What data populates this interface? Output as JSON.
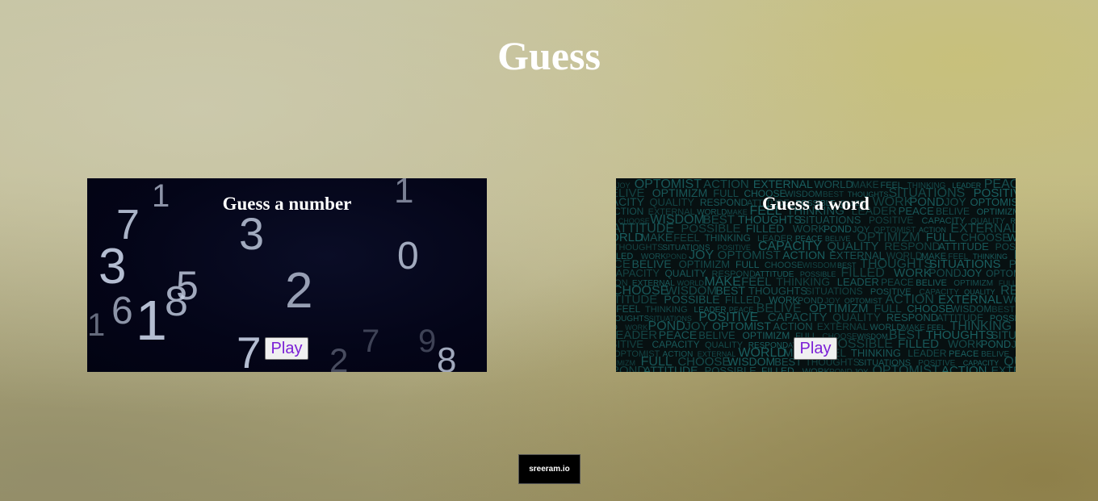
{
  "page": {
    "title": "Guess"
  },
  "cards": [
    {
      "title": "Guess a number",
      "play_label": "Play",
      "background_digits": [
        "7",
        "3",
        "1",
        "3",
        "5",
        "8",
        "6",
        "1",
        "2",
        "0",
        "1",
        "7",
        "2",
        "8",
        "9",
        "7",
        "1"
      ]
    },
    {
      "title": "Guess a word",
      "play_label": "Play",
      "background_words": [
        "JOY",
        "OPTOMIST",
        "ACTION",
        "EXTERNAL",
        "WORLD",
        "MAKE",
        "FEEL",
        "THINKING",
        "LEADER",
        "PEACE",
        "BELIVE",
        "OPTIMIZM",
        "FULL",
        "CHOOSE",
        "WISDOM",
        "BEST",
        "THOUGHTS",
        "SITUATIONS",
        "POSITIVE",
        "CAPACITY",
        "QUALITY",
        "RESPOND",
        "ATTITUDE",
        "POSSIBLE",
        "FILLED",
        "WORK",
        "POND"
      ]
    }
  ],
  "footer": {
    "badge_label": "sreeram.io"
  },
  "colors": {
    "play_text": "#7b1fd6",
    "number_card_bg": "#040518",
    "word_card_bg": "#071011",
    "word_text": "#1d6b6c"
  }
}
